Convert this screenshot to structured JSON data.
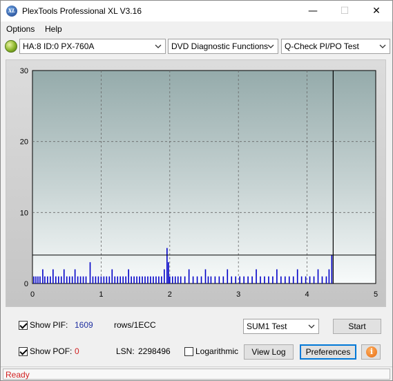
{
  "window": {
    "title": "PlexTools Professional XL V3.16",
    "app_icon_text": "XL",
    "minimize_glyph": "—",
    "maximize_glyph": "☐",
    "close_glyph": "✕"
  },
  "menu": {
    "items": [
      {
        "label": "Options",
        "mnemonic": "O"
      },
      {
        "label": "Help",
        "mnemonic": "H"
      }
    ]
  },
  "toolbar": {
    "drive_select": "HA:8 ID:0  PX-760A",
    "function_select": "DVD Diagnostic Functions",
    "test_select": "Q-Check PI/PO Test"
  },
  "chart_data": {
    "type": "bar",
    "x_range": [
      0,
      5
    ],
    "y_range": [
      0,
      30
    ],
    "x_ticks": [
      "0",
      "1",
      "2",
      "3",
      "4",
      "5"
    ],
    "y_ticks": [
      "0",
      "10",
      "20",
      "30"
    ],
    "grid": true,
    "threshold_line": 4,
    "end_marker_x": 4.38,
    "series": [
      {
        "color": "#0000c8",
        "points": [
          [
            0.02,
            1
          ],
          [
            0.05,
            1
          ],
          [
            0.08,
            1
          ],
          [
            0.11,
            1
          ],
          [
            0.15,
            2
          ],
          [
            0.18,
            1
          ],
          [
            0.22,
            1
          ],
          [
            0.26,
            1
          ],
          [
            0.3,
            2
          ],
          [
            0.34,
            1
          ],
          [
            0.38,
            1
          ],
          [
            0.42,
            1
          ],
          [
            0.46,
            2
          ],
          [
            0.5,
            1
          ],
          [
            0.54,
            1
          ],
          [
            0.58,
            1
          ],
          [
            0.62,
            2
          ],
          [
            0.66,
            1
          ],
          [
            0.7,
            1
          ],
          [
            0.74,
            1
          ],
          [
            0.78,
            1
          ],
          [
            0.84,
            3
          ],
          [
            0.88,
            1
          ],
          [
            0.92,
            1
          ],
          [
            0.96,
            1
          ],
          [
            1.0,
            1
          ],
          [
            1.04,
            1
          ],
          [
            1.08,
            1
          ],
          [
            1.12,
            1
          ],
          [
            1.16,
            2
          ],
          [
            1.2,
            1
          ],
          [
            1.24,
            1
          ],
          [
            1.28,
            1
          ],
          [
            1.32,
            1
          ],
          [
            1.36,
            1
          ],
          [
            1.4,
            2
          ],
          [
            1.44,
            1
          ],
          [
            1.48,
            1
          ],
          [
            1.52,
            1
          ],
          [
            1.56,
            1
          ],
          [
            1.6,
            1
          ],
          [
            1.64,
            1
          ],
          [
            1.68,
            1
          ],
          [
            1.72,
            1
          ],
          [
            1.76,
            1
          ],
          [
            1.8,
            1
          ],
          [
            1.84,
            1
          ],
          [
            1.88,
            1
          ],
          [
            1.92,
            2
          ],
          [
            1.96,
            5
          ],
          [
            1.98,
            3
          ],
          [
            2.0,
            1
          ],
          [
            2.04,
            1
          ],
          [
            2.08,
            1
          ],
          [
            2.12,
            1
          ],
          [
            2.16,
            1
          ],
          [
            2.22,
            1
          ],
          [
            2.28,
            2
          ],
          [
            2.34,
            1
          ],
          [
            2.4,
            1
          ],
          [
            2.46,
            1
          ],
          [
            2.52,
            2
          ],
          [
            2.56,
            1
          ],
          [
            2.6,
            1
          ],
          [
            2.66,
            1
          ],
          [
            2.72,
            1
          ],
          [
            2.78,
            1
          ],
          [
            2.84,
            2
          ],
          [
            2.9,
            1
          ],
          [
            2.96,
            1
          ],
          [
            3.02,
            1
          ],
          [
            3.08,
            1
          ],
          [
            3.14,
            1
          ],
          [
            3.2,
            1
          ],
          [
            3.26,
            2
          ],
          [
            3.32,
            1
          ],
          [
            3.38,
            1
          ],
          [
            3.44,
            1
          ],
          [
            3.5,
            1
          ],
          [
            3.56,
            2
          ],
          [
            3.62,
            1
          ],
          [
            3.68,
            1
          ],
          [
            3.74,
            1
          ],
          [
            3.8,
            1
          ],
          [
            3.86,
            2
          ],
          [
            3.92,
            1
          ],
          [
            3.98,
            1
          ],
          [
            4.04,
            1
          ],
          [
            4.1,
            1
          ],
          [
            4.16,
            2
          ],
          [
            4.22,
            1
          ],
          [
            4.28,
            1
          ],
          [
            4.32,
            2
          ],
          [
            4.36,
            4
          ]
        ]
      }
    ]
  },
  "controls": {
    "show_pif_label": "Show PIF:",
    "pif_value": "1609",
    "pif_unit": "rows/1ECC",
    "show_pof_label": "Show POF:",
    "pof_value": "0",
    "lsn_label": "LSN:",
    "lsn_value": "2298496",
    "logarithmic_label": "Logarithmic",
    "sum_select": "SUM1 Test",
    "start_button": "Start",
    "view_log_button": "View Log",
    "preferences_button": "Preferences",
    "info_glyph": "i",
    "show_pif_checked": true,
    "show_pof_checked": true,
    "logarithmic_checked": false
  },
  "status": {
    "text": "Ready"
  }
}
